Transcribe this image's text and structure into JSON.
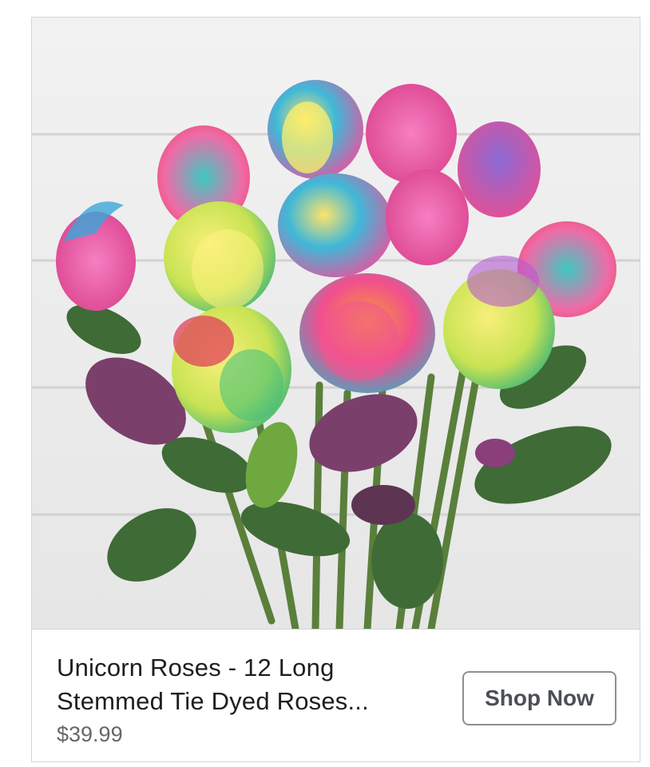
{
  "ad": {
    "image_alt": "Bouquet of rainbow tie-dyed long stemmed roses",
    "title_line1": "Unicorn Roses - 12 Long",
    "title_line2": "Stemmed Tie Dyed Roses...",
    "price": "$39.99",
    "cta_label": "Shop Now"
  },
  "colors": {
    "title_text": "#1c1e21",
    "price_text": "#65676b",
    "button_border": "#8c8f94",
    "button_text": "#4b4f56",
    "card_border": "#d3d6db",
    "wood_background": "#eeeeee",
    "leaf_green": "#3f6b36",
    "stem_green": "#5a7f3b"
  }
}
